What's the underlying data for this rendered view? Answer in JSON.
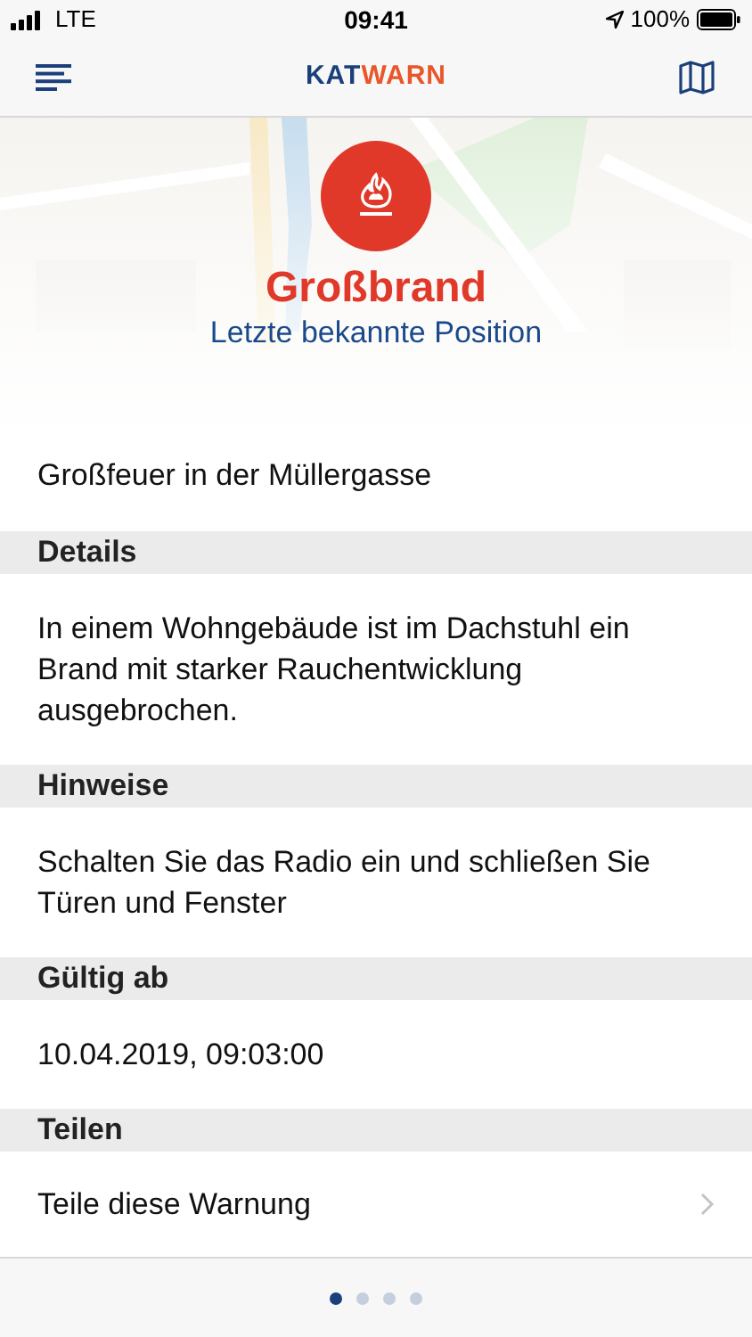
{
  "status_bar": {
    "carrier": "LTE",
    "time": "09:41",
    "battery": "100%"
  },
  "logo": [
    {
      "text": "KAT",
      "color": "#1b3f7a"
    },
    {
      "text": "WARN",
      "color": "#e8562a"
    }
  ],
  "alert": {
    "title": "Großbrand",
    "subtitle": "Letzte bekannte Position"
  },
  "rows": [
    {
      "kind": "text",
      "text": "Großfeuer in der Müllergasse"
    },
    {
      "kind": "header",
      "text": "Details"
    },
    {
      "kind": "text",
      "text": "In einem Wohngebäude ist im Dachstuhl ein Brand mit starker Rauchentwicklung ausgebrochen."
    },
    {
      "kind": "header",
      "text": "Hinweise"
    },
    {
      "kind": "text",
      "text": "Schalten Sie das Radio ein und schließen Sie Türen und Fenster"
    },
    {
      "kind": "header",
      "text": "Gültig ab"
    },
    {
      "kind": "text",
      "text": "10.04.2019, 09:03:00"
    },
    {
      "kind": "header",
      "text": "Teilen"
    },
    {
      "kind": "link",
      "text": "Teile diese Warnung"
    }
  ],
  "pager": [
    {
      "selected": true
    },
    {
      "selected": false
    },
    {
      "selected": false
    },
    {
      "selected": false
    }
  ]
}
